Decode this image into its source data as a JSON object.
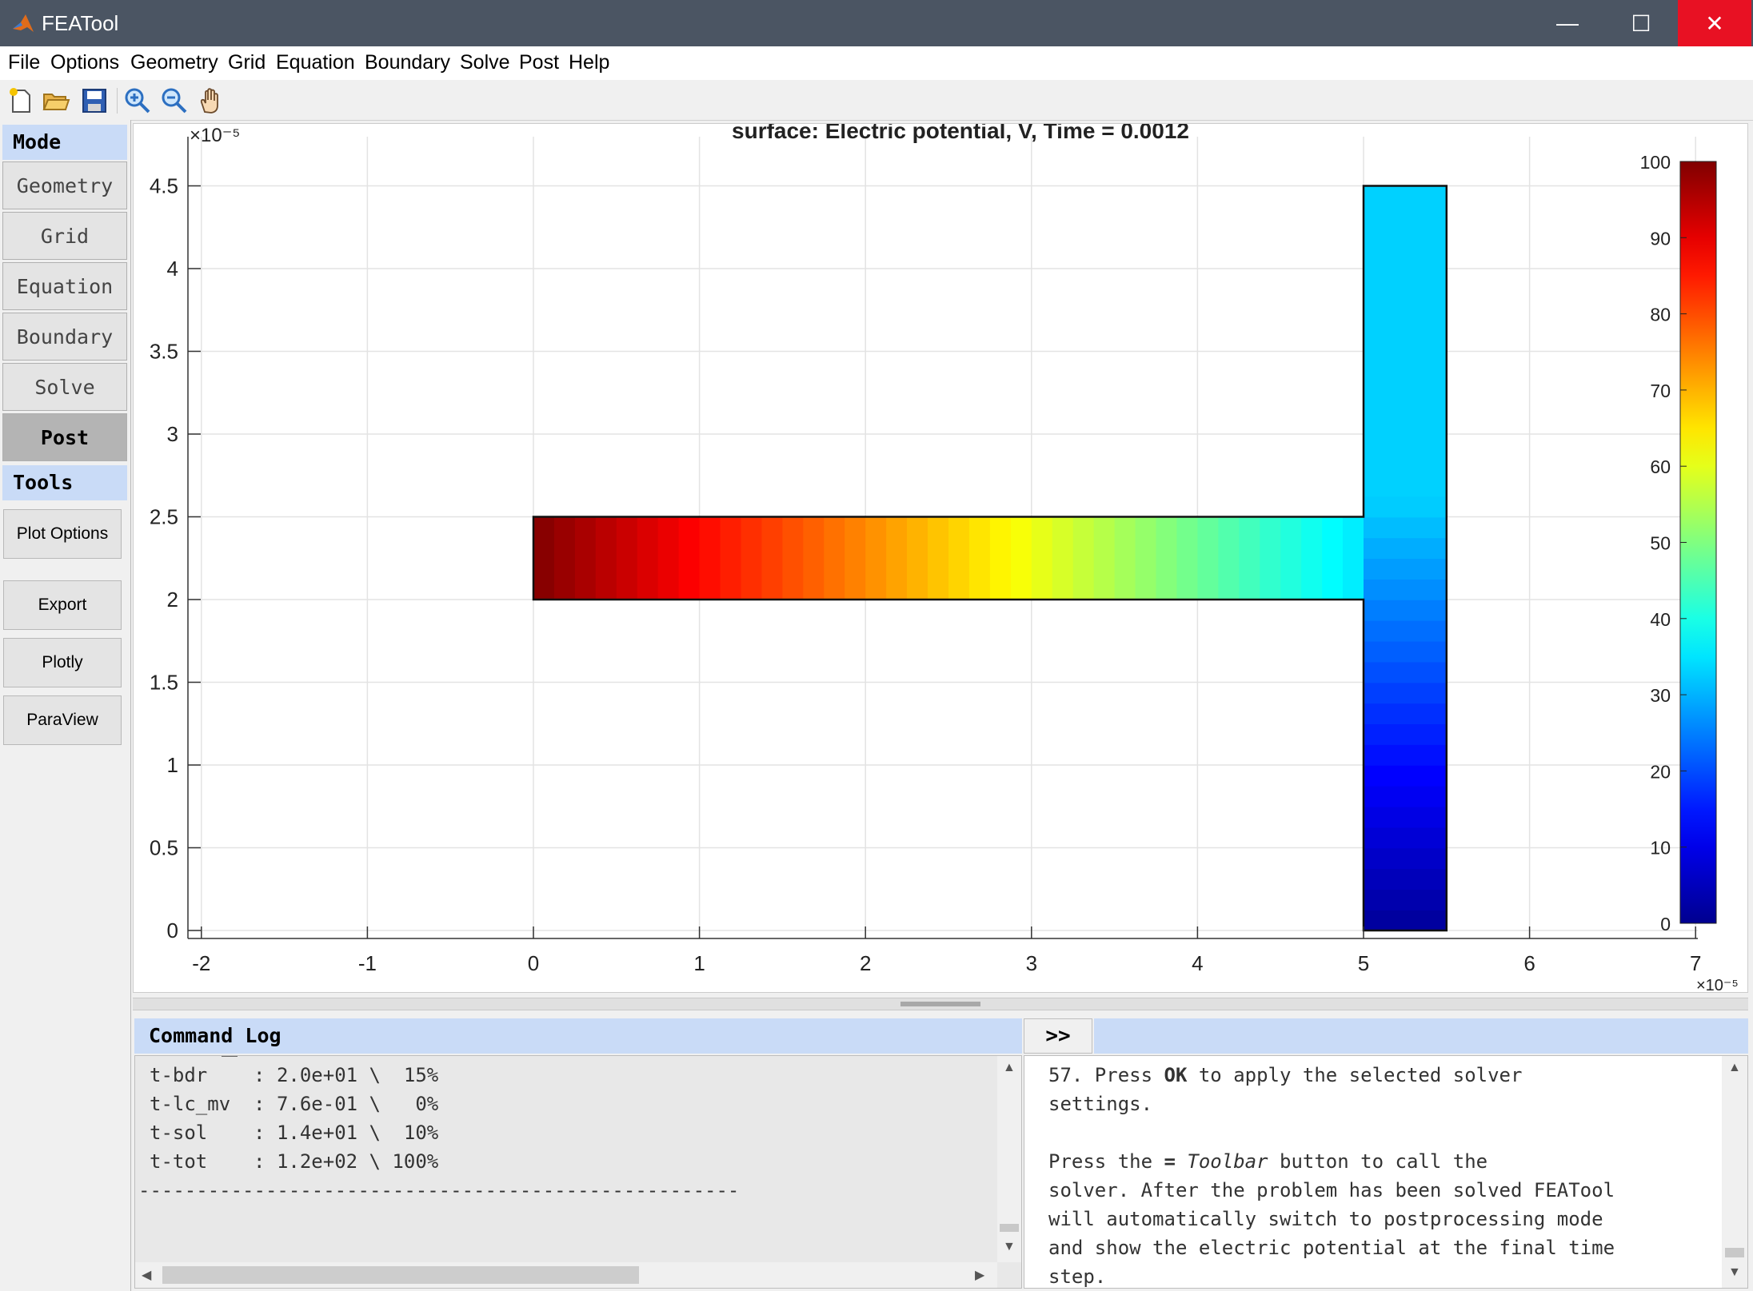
{
  "window": {
    "title": "FEATool",
    "minimize_glyph": "—",
    "maximize_glyph": "☐",
    "close_glyph": "✕",
    "close_color": "#e81123"
  },
  "menu": [
    "File",
    "Options",
    "Geometry",
    "Grid",
    "Equation",
    "Boundary",
    "Solve",
    "Post",
    "Help"
  ],
  "toolbar": {
    "icons": [
      "new-file-icon",
      "open-folder-icon",
      "save-icon",
      "zoom-in-icon",
      "zoom-out-icon",
      "pan-hand-icon"
    ]
  },
  "sidebar": {
    "mode_header": "Mode",
    "modes": [
      "Geometry",
      "Grid",
      "Equation",
      "Boundary",
      "Solve",
      "Post"
    ],
    "active_mode": "Post",
    "tools_header": "Tools",
    "tools": [
      "Plot Options",
      "Export",
      "Plotly",
      "ParaView"
    ]
  },
  "plot": {
    "title": "surface: Electric potential, V, Time = 0.0012",
    "y_exponent": "×10⁻⁵",
    "x_exponent": "×10⁻⁵",
    "yticks": [
      "4.5",
      "4",
      "3.5",
      "3",
      "2.5",
      "2",
      "1.5",
      "1",
      "0.5",
      "0"
    ],
    "xticks": [
      "-2",
      "-1",
      "0",
      "1",
      "2",
      "3",
      "4",
      "5",
      "6",
      "7"
    ],
    "colorbar_ticks": [
      "100",
      "90",
      "80",
      "70",
      "60",
      "50",
      "40",
      "30",
      "20",
      "10",
      "0"
    ],
    "colormap": [
      "#00008f",
      "#0000ff",
      "#00ffff",
      "#ffff00",
      "#ff0000",
      "#800000"
    ]
  },
  "chart_data": {
    "type": "heatmap",
    "title": "surface: Electric potential, V, Time = 0.0012",
    "xlim": [
      -2,
      7.4
    ],
    "ylim": [
      -0.2,
      4.6
    ],
    "scale_exponent": -5,
    "color_range": [
      0,
      100
    ],
    "domains": [
      {
        "name": "horizontal channel",
        "x": [
          0,
          5
        ],
        "y": [
          2,
          2.5
        ],
        "value_left": 100,
        "value_right": 35
      },
      {
        "name": "vertical channel",
        "x": [
          5,
          5.5
        ],
        "y": [
          0,
          4.5
        ],
        "value_top": 33,
        "value_bottom": 1
      }
    ],
    "grid": true
  },
  "command_log": {
    "header": "Command Log",
    "lines": [
      "t-bdr    : 2.0e+01 \\  15%",
      "t-lc_mv  : 7.6e-01 \\   0%",
      "t-sol    : 1.4e+01 \\  10%",
      "t-tot    : 1.2e+02 \\ 100%",
      "----------------------------------------------------"
    ]
  },
  "expand_button": ">>",
  "help": {
    "lines": [
      "57. Press OK to apply the selected solver",
      "settings.",
      "",
      "Press the = Toolbar button to call the",
      "solver. After the problem has been solved FEATool",
      "will automatically switch to postprocessing mode",
      "and show the electric potential at the final time",
      "step."
    ]
  }
}
